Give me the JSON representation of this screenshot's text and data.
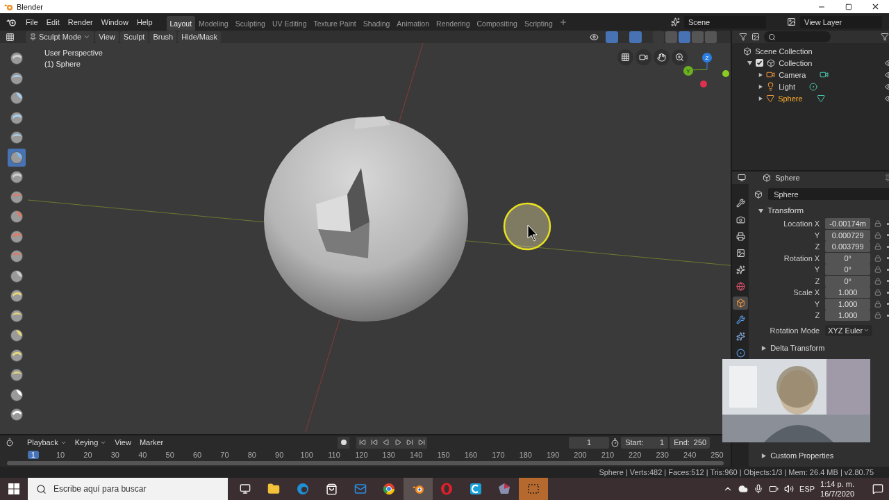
{
  "window": {
    "title": "Blender"
  },
  "menu": [
    "File",
    "Edit",
    "Render",
    "Window",
    "Help"
  ],
  "workspaces": [
    {
      "label": "Layout",
      "selected": true
    },
    {
      "label": "Modeling",
      "selected": false
    },
    {
      "label": "Sculpting",
      "selected": false
    },
    {
      "label": "UV Editing",
      "selected": false
    },
    {
      "label": "Texture Paint",
      "selected": false
    },
    {
      "label": "Shading",
      "selected": false
    },
    {
      "label": "Animation",
      "selected": false
    },
    {
      "label": "Rendering",
      "selected": false
    },
    {
      "label": "Compositing",
      "selected": false
    },
    {
      "label": "Scripting",
      "selected": false
    }
  ],
  "scene": "Scene",
  "view_layer": "View Layer",
  "viewport_header": {
    "mode": "Sculpt Mode",
    "menus": [
      "View",
      "Sculpt",
      "Brush",
      "Hide/Mask"
    ]
  },
  "viewport": {
    "perspective": "User Perspective",
    "object": "(1) Sphere",
    "gizmo_axes": [
      "Z",
      "Y"
    ]
  },
  "tools": [
    {
      "selected": false,
      "color": "#d0d0d0"
    },
    {
      "selected": false,
      "color": "#a8d0f0"
    },
    {
      "selected": false,
      "color": "#a8d0f0"
    },
    {
      "selected": false,
      "color": "#a8d0f0"
    },
    {
      "selected": false,
      "color": "#a8d0f0"
    },
    {
      "selected": true,
      "color": "#7ab8f5"
    },
    {
      "selected": false,
      "color": "#d0d0d0"
    },
    {
      "selected": false,
      "color": "#e07a68"
    },
    {
      "selected": false,
      "color": "#e07a68"
    },
    {
      "selected": false,
      "color": "#e07a68"
    },
    {
      "selected": false,
      "color": "#e07a68"
    },
    {
      "selected": false,
      "color": "#d0d0d0"
    },
    {
      "selected": false,
      "color": "#e6d77a"
    },
    {
      "selected": false,
      "color": "#e6d77a"
    },
    {
      "selected": false,
      "color": "#e6d77a"
    },
    {
      "selected": false,
      "color": "#e6d77a"
    },
    {
      "selected": false,
      "color": "#e6d77a"
    },
    {
      "selected": false,
      "color": "#ffffff"
    },
    {
      "selected": false,
      "color": "#ffffff"
    }
  ],
  "outliner": {
    "root": "Scene Collection",
    "children": [
      {
        "label": "Collection",
        "checked": true,
        "expanded": true,
        "children": [
          {
            "label": "Camera",
            "kind": "camera",
            "selected": false
          },
          {
            "label": "Light",
            "kind": "light",
            "selected": false
          },
          {
            "label": "Sphere",
            "kind": "mesh",
            "selected": true
          }
        ]
      }
    ]
  },
  "properties": {
    "header": "Sphere",
    "object_name": "Sphere",
    "tabs": [
      {
        "kind": "tool",
        "selected": false
      },
      {
        "kind": "render",
        "selected": false
      },
      {
        "kind": "output",
        "selected": false
      },
      {
        "kind": "view-layer",
        "selected": false
      },
      {
        "kind": "scene",
        "selected": false
      },
      {
        "kind": "world",
        "selected": false
      },
      {
        "kind": "object",
        "selected": true
      },
      {
        "kind": "modifier",
        "selected": false
      },
      {
        "kind": "particles",
        "selected": false
      },
      {
        "kind": "physics",
        "selected": false
      }
    ],
    "panel": {
      "title": "Transform",
      "expanded": true
    },
    "rows": [
      {
        "label": "Location X",
        "value": "-0.00174m"
      },
      {
        "label": "Y",
        "value": "0.000729"
      },
      {
        "label": "Z",
        "value": "0.003799"
      },
      {
        "label": "Rotation X",
        "value": "0°"
      },
      {
        "label": "Y",
        "value": "0°"
      },
      {
        "label": "Z",
        "value": "0°"
      },
      {
        "label": "Scale X",
        "value": "1.000"
      },
      {
        "label": "Y",
        "value": "1.000"
      },
      {
        "label": "Z",
        "value": "1.000"
      }
    ],
    "rotation_mode": {
      "label": "Rotation Mode",
      "value": "XYZ Euler"
    },
    "collapsed_panels": [
      "Delta Transform",
      "Custom Properties"
    ]
  },
  "timeline": {
    "menus": [
      "Playback",
      "Keying",
      "View",
      "Marker"
    ],
    "current_frame": "1",
    "start_label": "Start:",
    "start": "1",
    "end_label": "End:",
    "end": "250",
    "ruler": [
      {
        "label": "1",
        "selected": true
      },
      {
        "label": "10",
        "selected": false
      },
      {
        "label": "20",
        "selected": false
      },
      {
        "label": "30",
        "selected": false
      },
      {
        "label": "40",
        "selected": false
      },
      {
        "label": "50",
        "selected": false
      },
      {
        "label": "60",
        "selected": false
      },
      {
        "label": "70",
        "selected": false
      },
      {
        "label": "80",
        "selected": false
      },
      {
        "label": "90",
        "selected": false
      },
      {
        "label": "100",
        "selected": false
      },
      {
        "label": "110",
        "selected": false
      },
      {
        "label": "120",
        "selected": false
      },
      {
        "label": "130",
        "selected": false
      },
      {
        "label": "140",
        "selected": false
      },
      {
        "label": "150",
        "selected": false
      },
      {
        "label": "160",
        "selected": false
      },
      {
        "label": "170",
        "selected": false
      },
      {
        "label": "180",
        "selected": false
      },
      {
        "label": "190",
        "selected": false
      },
      {
        "label": "200",
        "selected": false
      },
      {
        "label": "210",
        "selected": false
      },
      {
        "label": "220",
        "selected": false
      },
      {
        "label": "230",
        "selected": false
      },
      {
        "label": "240",
        "selected": false
      },
      {
        "label": "250",
        "selected": false
      }
    ]
  },
  "status_bar": "Sphere | Verts:482 | Faces:512 | Tris:960 | Objects:1/3 | Mem: 26.4 MB | v2.80.75",
  "taskbar": {
    "search_placeholder": "Escribe aquí para buscar",
    "apps": [
      {
        "kind": "task-view",
        "selected": false
      },
      {
        "kind": "folder",
        "selected": false
      },
      {
        "kind": "edge",
        "selected": false
      },
      {
        "kind": "store",
        "selected": false
      },
      {
        "kind": "mail",
        "selected": false
      },
      {
        "kind": "chrome",
        "selected": false
      },
      {
        "kind": "blender",
        "selected": true
      },
      {
        "kind": "opera",
        "selected": false
      },
      {
        "kind": "cleaner",
        "selected": false
      },
      {
        "kind": "gem",
        "selected": false
      },
      {
        "kind": "snip",
        "selected": false
      }
    ],
    "language": "ESP",
    "time": "1:14 p. m.",
    "date": "16/7/2020"
  }
}
